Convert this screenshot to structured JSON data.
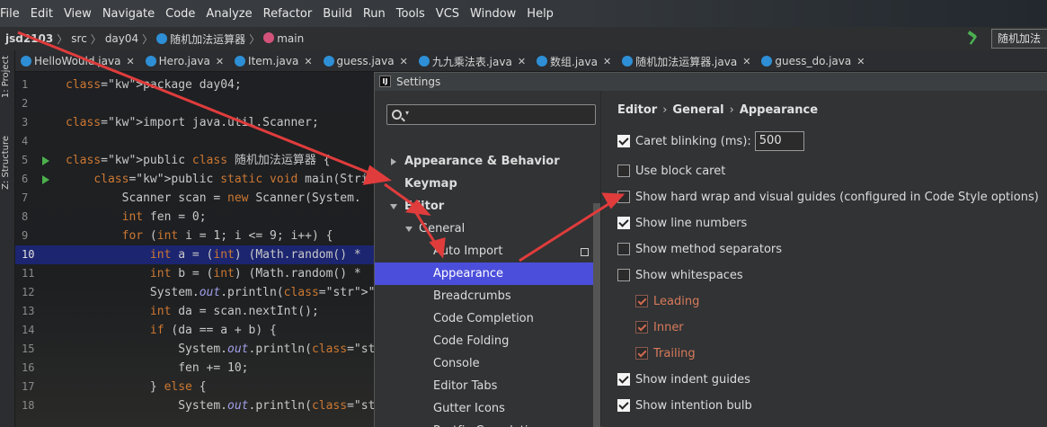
{
  "menubar": {
    "items": [
      "File",
      "Edit",
      "View",
      "Navigate",
      "Code",
      "Analyze",
      "Refactor",
      "Build",
      "Run",
      "Tools",
      "VCS",
      "Window",
      "Help"
    ]
  },
  "navbar": {
    "project": "jsd2103",
    "crumbs": [
      "src",
      "day04",
      "随机加法运算器",
      "main"
    ],
    "run_config": "随机加法"
  },
  "leftstrip": {
    "project_label": "1: Project",
    "structure_label": "Z: Structure"
  },
  "tabs": [
    {
      "label": "HelloWould.java"
    },
    {
      "label": "Hero.java"
    },
    {
      "label": "Item.java"
    },
    {
      "label": "guess.java"
    },
    {
      "label": "九九乘法表.java"
    },
    {
      "label": "数组.java"
    },
    {
      "label": "随机加法运算器.java"
    },
    {
      "label": "guess_do.java"
    }
  ],
  "editor": {
    "line_numbers": [
      "1",
      "2",
      "3",
      "4",
      "5",
      "6",
      "7",
      "8",
      "9",
      "10",
      "11",
      "12",
      "13",
      "14",
      "15",
      "16",
      "17",
      "18"
    ],
    "run_markers": [
      "5",
      "6"
    ],
    "current_line": "10",
    "lines": [
      "package day04;",
      "",
      "import java.util.Scanner;",
      "",
      "public class 随机加法运算器 {",
      "    public static void main(String[] args)",
      "        Scanner scan = new Scanner(System.",
      "        int fen = 0;",
      "        for (int i = 1; i <= 9; i++) {",
      "            int a = (int) (Math.random() *",
      "            int b = (int) (Math.random() *",
      "            System.out.println(\"(\" + i + \"",
      "            int da = scan.nextInt();",
      "            if (da == a + b) {",
      "                System.out.println(\"答对了\"",
      "                fen += 10;",
      "            } else {",
      "                System.out.println(\"答错了\""
    ]
  },
  "dialog": {
    "title": "Settings",
    "tree": {
      "appearance_behavior": "Appearance & Behavior",
      "keymap": "Keymap",
      "editor": "Editor",
      "general": "General",
      "children": [
        "Auto Import",
        "Appearance",
        "Breadcrumbs",
        "Code Completion",
        "Code Folding",
        "Console",
        "Editor Tabs",
        "Gutter Icons",
        "Postfix Completion"
      ]
    },
    "breadcrumb": [
      "Editor",
      "General",
      "Appearance"
    ],
    "options": {
      "caret_blinking": "Caret blinking (ms):",
      "caret_blinking_value": "500",
      "block_caret": "Use block caret",
      "hard_wrap": "Show hard wrap and visual guides (configured in Code Style options)",
      "line_numbers": "Show line numbers",
      "method_separators": "Show method separators",
      "whitespaces": "Show whitespaces",
      "leading": "Leading",
      "inner": "Inner",
      "trailing": "Trailing",
      "indent_guides": "Show indent guides",
      "intention_bulb": "Show intention bulb"
    }
  },
  "colors": {
    "selection": "#4b4edb",
    "annotation_arrows": "#e03c3c"
  }
}
